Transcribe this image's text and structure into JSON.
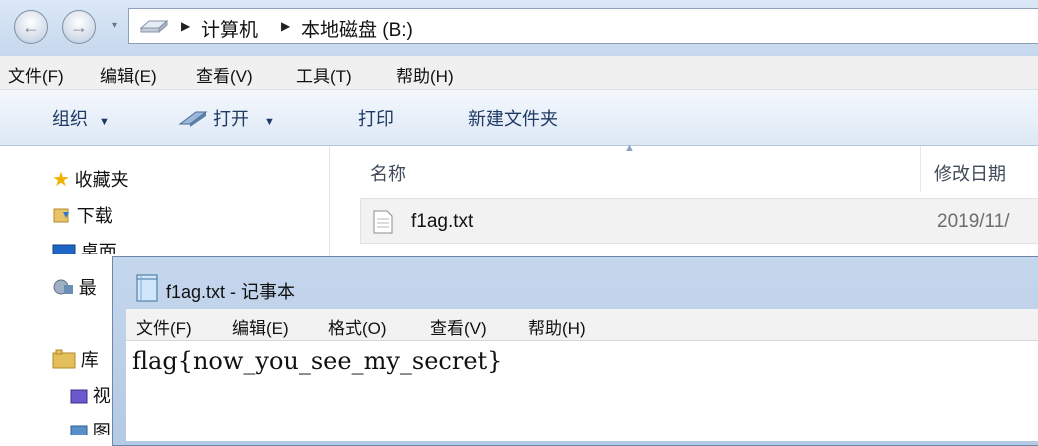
{
  "explorer": {
    "address": {
      "part1": "计算机",
      "part2": "本地磁盘 (B:)"
    },
    "menu": [
      "文件(F)",
      "编辑(E)",
      "查看(V)",
      "工具(T)",
      "帮助(H)"
    ],
    "toolbar": {
      "organize": "组织",
      "open": "打开",
      "print": "打印",
      "new_folder": "新建文件夹"
    },
    "nav": {
      "favorites": "收藏夹",
      "downloads": "下载",
      "desktop": "桌面",
      "recent_partial": "最",
      "libraries": "库",
      "videos_partial": "视",
      "pictures_partial": "图"
    },
    "columns": {
      "name": "名称",
      "modified": "修改日期"
    },
    "file": {
      "name": "f1ag.txt",
      "date_partial": "2019/11/"
    }
  },
  "notepad": {
    "title": "f1ag.txt - 记事本",
    "menu": [
      "文件(F)",
      "编辑(E)",
      "格式(O)",
      "查看(V)",
      "帮助(H)"
    ],
    "content": "flag{now_you_see_my_secret}"
  },
  "colors": {
    "accent": "#1e3a64",
    "title_gradient_top": "#dbe8f6",
    "notepad_frame": "#c5d7ed"
  }
}
